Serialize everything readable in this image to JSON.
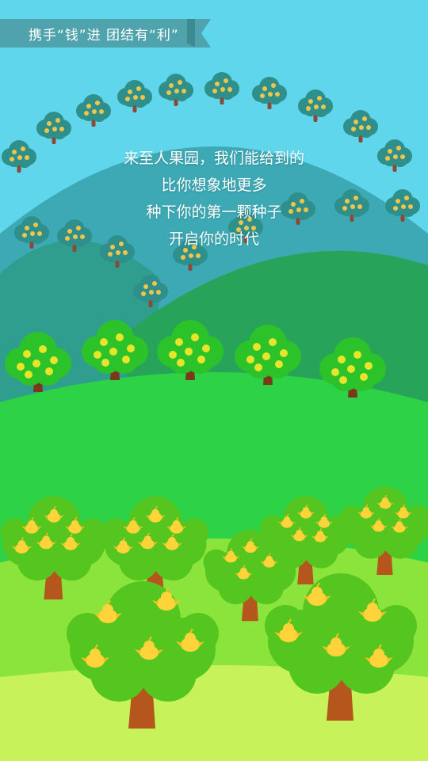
{
  "banner": {
    "title": "携手“钱”进  团结有“利”"
  },
  "slogan": {
    "lines": [
      "来至人果园，我们能给到的",
      "比你想象地更多",
      "种下你的第一颗种子",
      "开启你的时代"
    ]
  },
  "colors": {
    "sky": "#5fd6ec",
    "back_hill": "#3da9b5",
    "mid_hill": "#2f9e8e",
    "front_green": "#2ed246",
    "lime_field": "#8be43c",
    "pale_field": "#c8f25a",
    "banner": "#4fa3ad",
    "tree_trunk": "#b5561c",
    "chick": "#ffd33a"
  },
  "icons": [
    "money-tree-icon",
    "chick-fruit-icon",
    "ribbon-banner-icon"
  ]
}
